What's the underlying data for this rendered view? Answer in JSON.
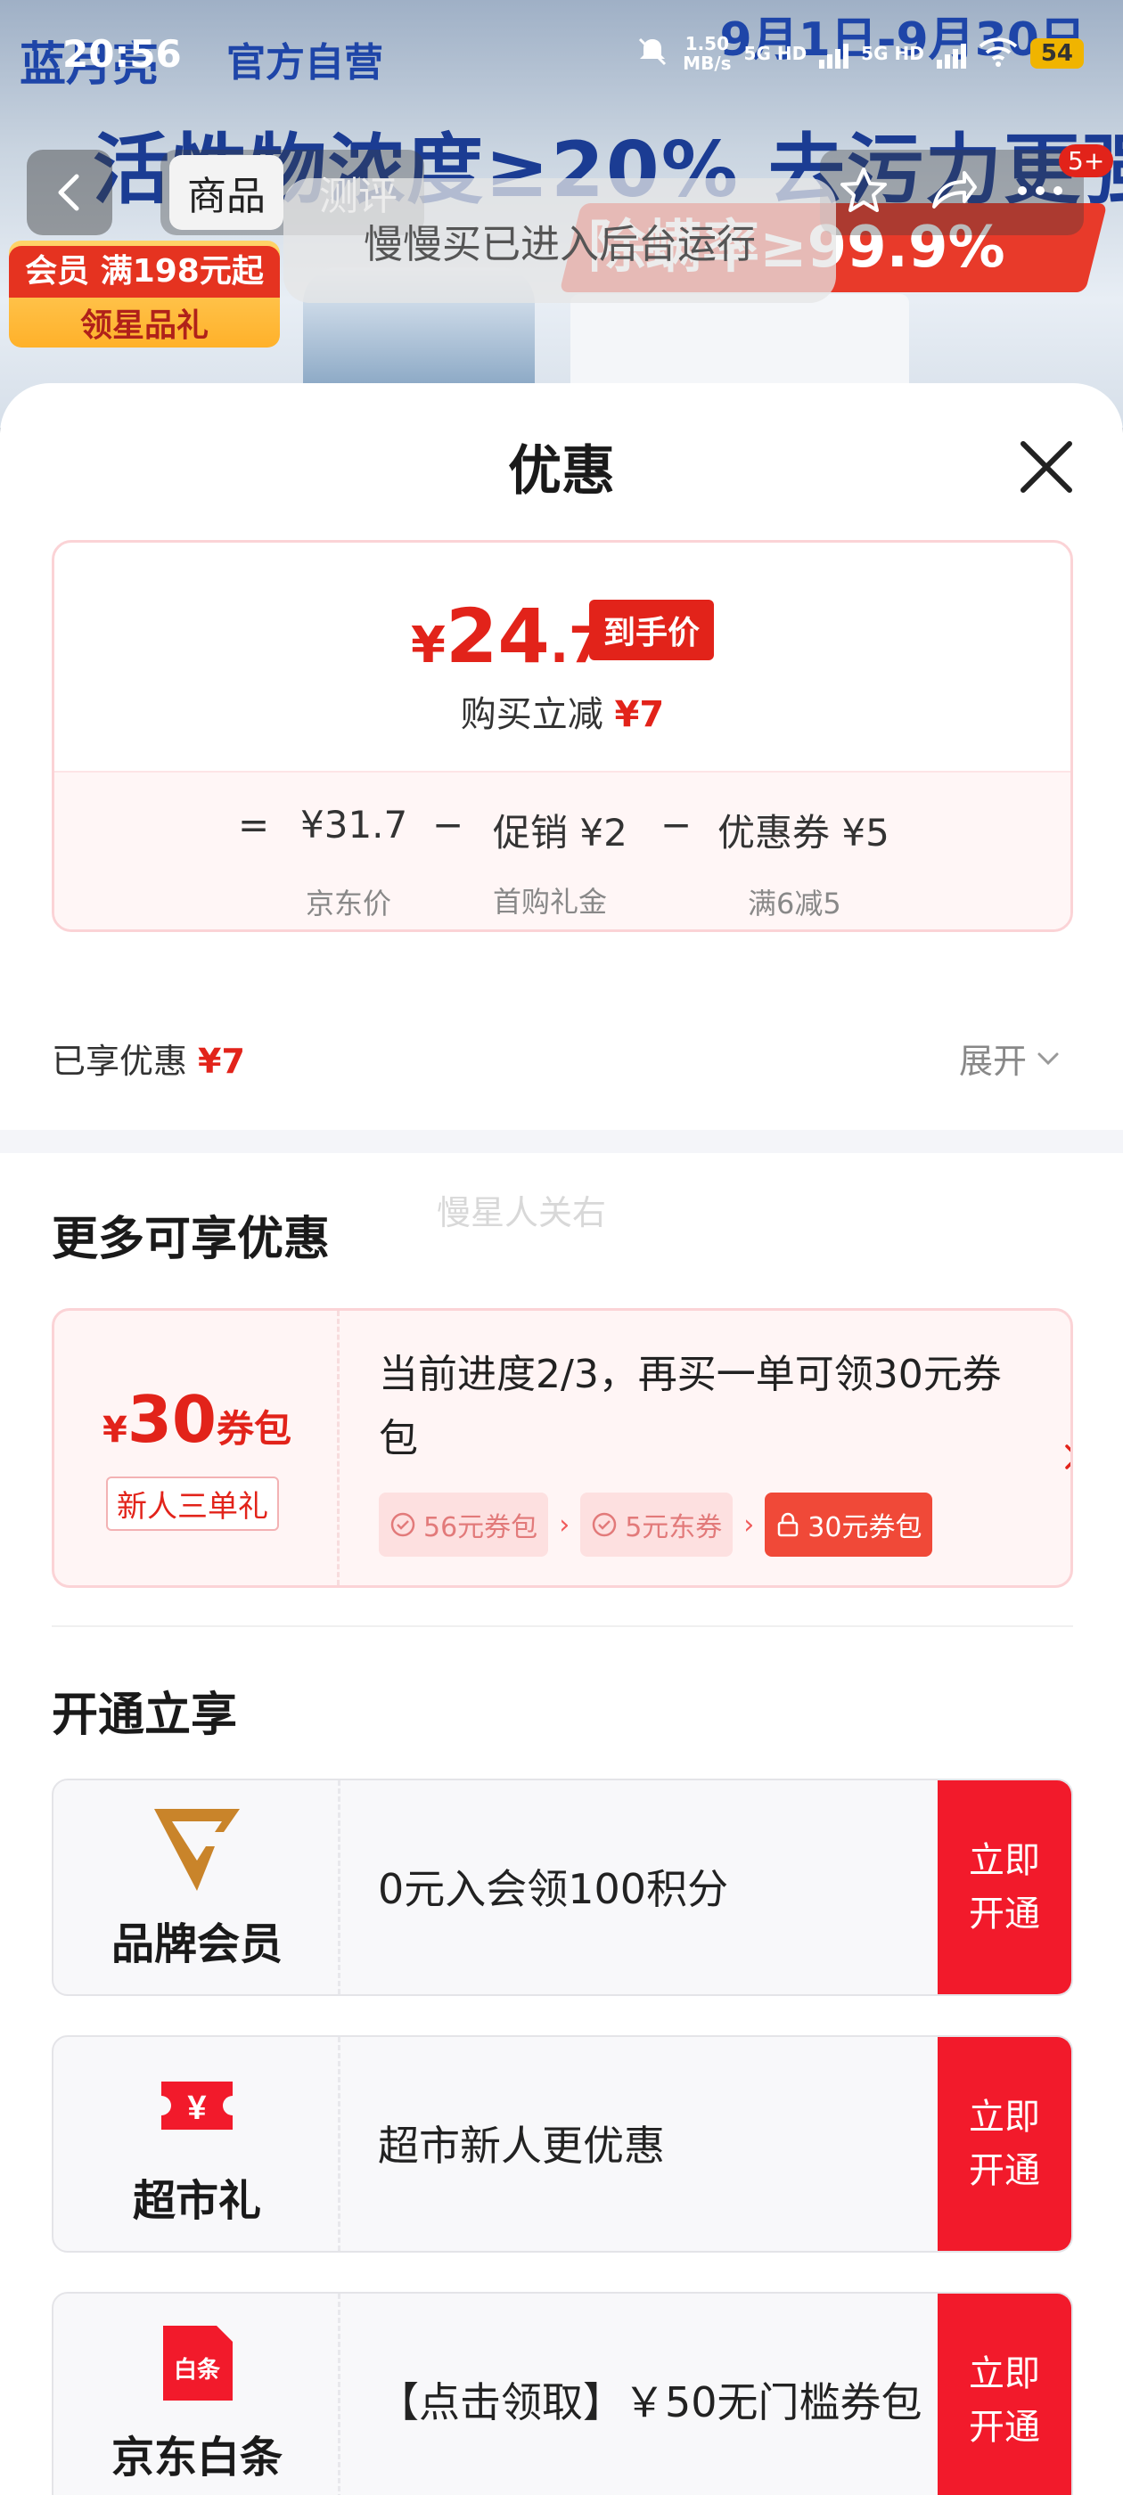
{
  "status_bar": {
    "time": "20:56",
    "net_speed": "1.50",
    "net_unit": "MB/s",
    "signal1": "5G HD",
    "signal2": "5G HD",
    "battery": "54"
  },
  "background": {
    "brand": "蓝月亮",
    "self_operated": "官方自营",
    "date_range": "9月1日-9月30日",
    "headline": "活性物浓度≥20% 去污力更强",
    "ribbon": "除螨率≥99.9%",
    "member_badge_line1": "会员 满198元起",
    "member_badge_line2": "领星品礼"
  },
  "nav": {
    "tabs": [
      "商品",
      "测评"
    ],
    "cart_badge": "5+",
    "toast": "慢慢买已进入后台运行"
  },
  "sheet": {
    "title": "优惠",
    "price": {
      "yen": "¥",
      "integer": "24",
      "decimal": ".7",
      "tag": "到手价",
      "instant_cut_label": "购买立减",
      "instant_cut_amount": "¥7"
    },
    "formula": {
      "equals": "=",
      "jd_price": "¥31.7",
      "minus1": "−",
      "promo": "促销 ¥2",
      "minus2": "−",
      "coupon": "优惠券 ¥5",
      "jd_price_label": "京东价",
      "promo_label": "首购礼金\n2",
      "coupon_label": "满6减5"
    },
    "enjoyed_label": "已享优惠",
    "enjoyed_amount": "¥7",
    "expand_label": "展开",
    "watermark": "慢星人关右",
    "more_title": "更多可享优惠",
    "pack": {
      "yen": "¥",
      "amount": "30",
      "unit": "券包",
      "label": "新人三单礼",
      "description": "当前进度2/3，再买一单可领30元券包",
      "steps": [
        "56元券包",
        "5元东券",
        "30元券包"
      ]
    },
    "open_title": "开通立享",
    "memberships": [
      {
        "name": "品牌会员",
        "desc": "0元入会领100积分",
        "button": "立即开通",
        "icon": "brand-member-icon"
      },
      {
        "name": "超市礼",
        "desc": "超市新人更优惠",
        "button": "立即开通",
        "icon": "supermarket-gift-icon"
      },
      {
        "name": "京东白条",
        "desc": "【点击领取】￥50无门槛券包",
        "button": "立即开通",
        "icon": "baitiao-icon",
        "icon_text": "白条"
      }
    ]
  },
  "colors": {
    "accent_red": "#e2231a",
    "button_red": "#f21a2b",
    "brand_gold": "#c9842a"
  }
}
